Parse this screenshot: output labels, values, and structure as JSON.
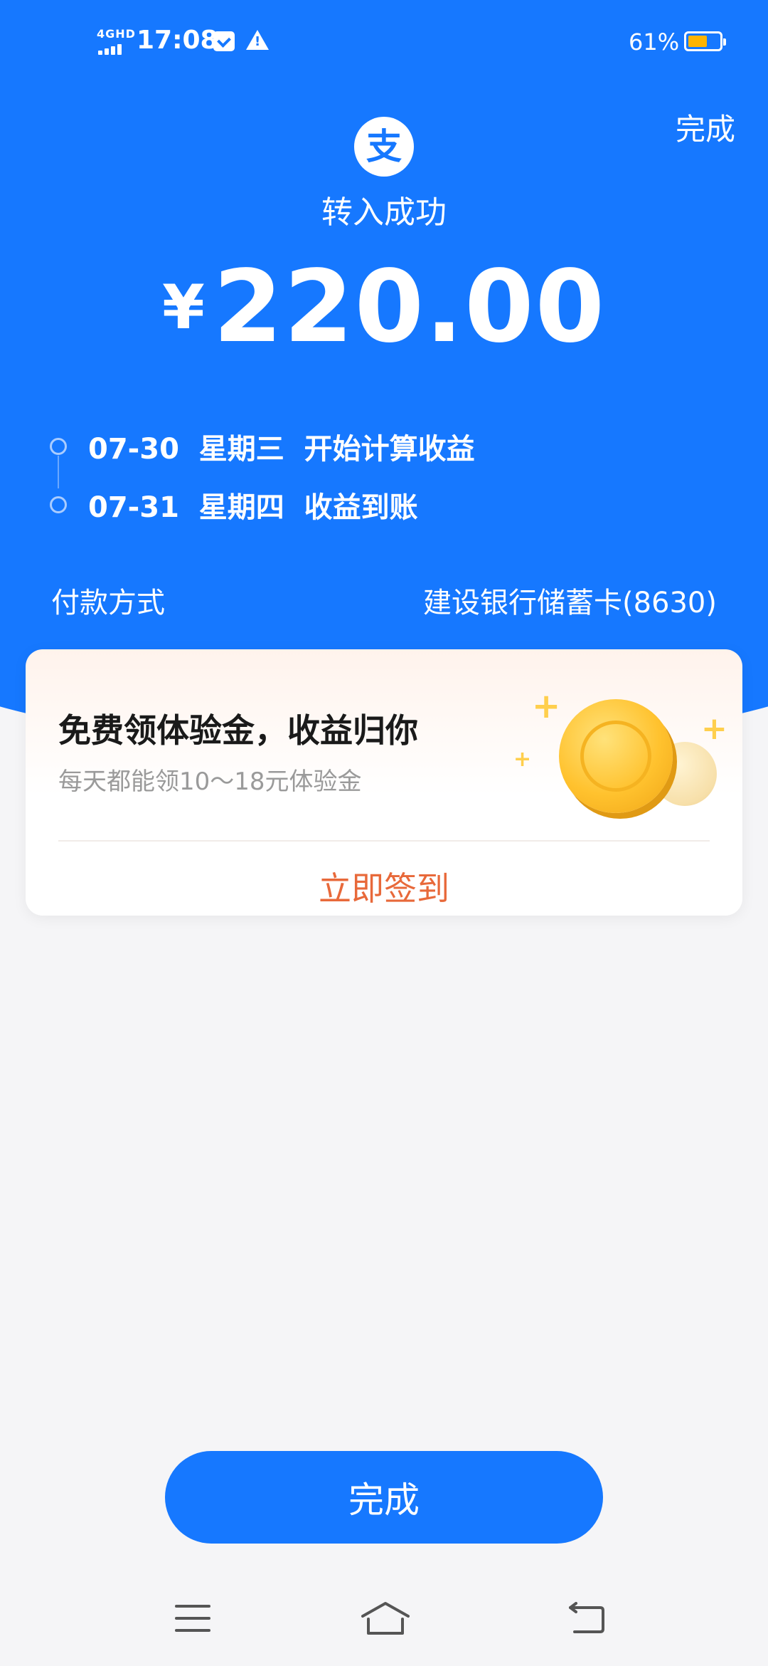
{
  "status_bar": {
    "network": "4GHD",
    "time": "17:08",
    "battery_percent": "61%",
    "battery_level": 0.61,
    "icons": [
      "signal-icon",
      "mail-icon",
      "warning-icon",
      "battery-icon"
    ]
  },
  "header": {
    "done_link": "完成",
    "logo_char": "支",
    "title": "转入成功",
    "currency_symbol": "¥",
    "amount": "220.00"
  },
  "timeline": [
    {
      "date": "07-30",
      "weekday": "星期三",
      "label": "开始计算收益"
    },
    {
      "date": "07-31",
      "weekday": "星期四",
      "label": "收益到账"
    }
  ],
  "payment": {
    "label": "付款方式",
    "value": "建设银行储蓄卡(8630)"
  },
  "promo_card": {
    "title": "免费领体验金，收益归你",
    "subtitle": "每天都能领10～18元体验金",
    "action": "立即签到"
  },
  "footer": {
    "done_button": "完成"
  },
  "nav_bar": {
    "icons": [
      "menu-icon",
      "home-icon",
      "back-icon"
    ]
  },
  "colors": {
    "primary_blue": "#1678ff",
    "promo_orange": "#e8693a",
    "coin_gold": "#ffc22e"
  }
}
